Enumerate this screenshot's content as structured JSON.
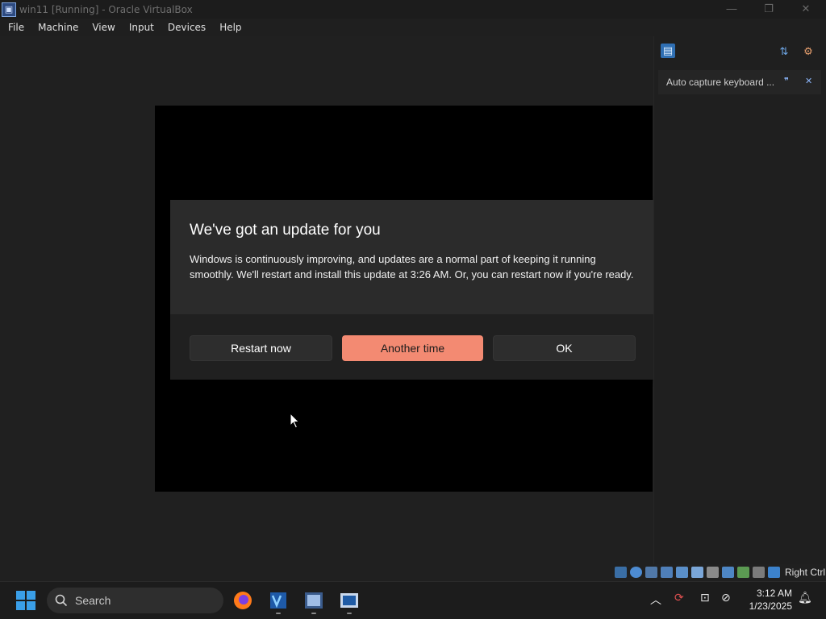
{
  "window": {
    "title": "win11 [Running] - Oracle VirtualBox",
    "controls": [
      "minimize",
      "maximize",
      "close"
    ]
  },
  "menubar": {
    "items": [
      "File",
      "Machine",
      "View",
      "Input",
      "Devices",
      "Help"
    ]
  },
  "dialog": {
    "title": "We've got an update for you",
    "message": "Windows is continuously improving, and updates are a normal part of keeping it running smoothly. We'll restart and install this update at 3:26 AM. Or, you can restart now if you're ready.",
    "buttons": {
      "restart_now": "Restart now",
      "another_time": "Another time",
      "ok": "OK"
    },
    "accent_color": "#f38a72"
  },
  "side_panel": {
    "notice_text": "Auto capture keyboard ..."
  },
  "statusbar": {
    "host_key_label": "Right Ctrl"
  },
  "taskbar": {
    "search_placeholder": "Search",
    "apps": [
      "firefox-icon",
      "virtualbox-icon",
      "virtualbox-manager-icon",
      "vm-window-icon"
    ],
    "clock": {
      "time": "3:12 AM",
      "date": "1/23/2025"
    }
  }
}
